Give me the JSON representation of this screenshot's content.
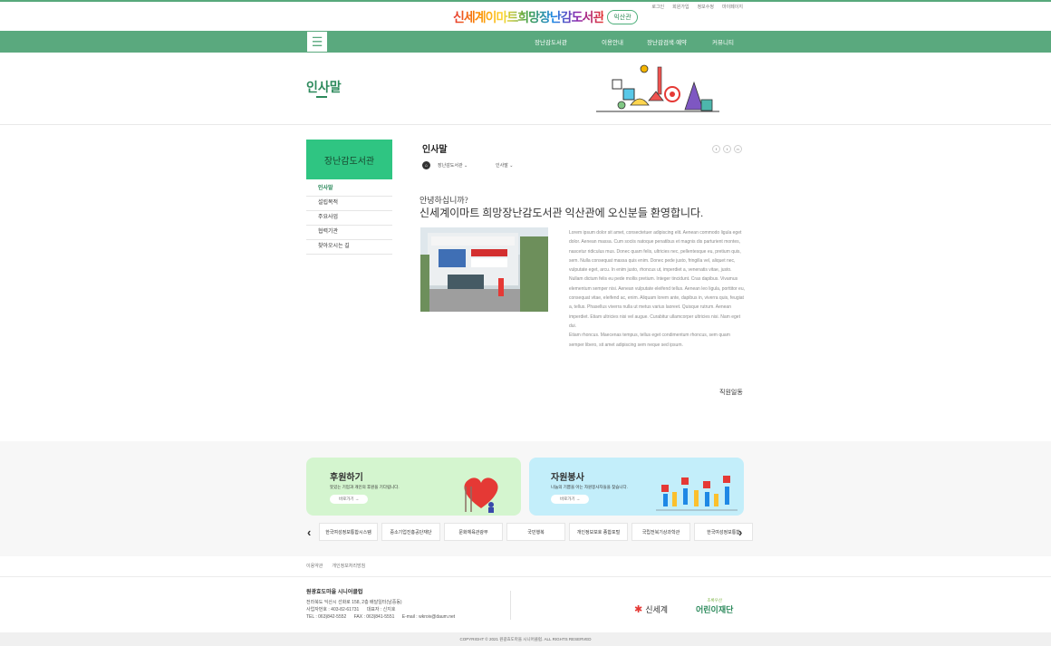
{
  "header": {
    "logo_text": "신세계이마트희망장난감도서관",
    "logo_badge": "익산관",
    "util_links": [
      "로그인",
      "회원가입",
      "정보수정",
      "마이페이지"
    ]
  },
  "nav": {
    "items": [
      "장난감도서관",
      "이용안내",
      "장난감검색·예약",
      "커뮤니티"
    ]
  },
  "banner": {
    "title": "인사말"
  },
  "sidebar": {
    "heading": "장난감도서관",
    "items": [
      {
        "label": "인사말",
        "active": true
      },
      {
        "label": "설립목적",
        "active": false
      },
      {
        "label": "주요사업",
        "active": false
      },
      {
        "label": "협력기관",
        "active": false
      },
      {
        "label": "찾아오시는 길",
        "active": false
      }
    ]
  },
  "content": {
    "title": "인사말",
    "share_icons": [
      "facebook-icon",
      "twitter-icon",
      "naver-icon"
    ],
    "breadcrumb": [
      "장난감도서관",
      "인사말"
    ],
    "greeting_small": "안녕하십니까?",
    "greeting_large": "신세계이마트 희망장난감도서관 익산관에 오신분들 환영합니다.",
    "body": "Lorem ipsum dolor sit amet, consectetuer adipiscing elit. Aenean commodo ligula eget dolor. Aenean massa. Cum sociis natoque penatibus et magnis dis parturient montes, nascetur ridiculus mus. Donec quam felis, ultricies nec, pellentesque eu, pretium quis, sem. Nulla consequat massa quis enim. Donec pede justo, fringilla vel, aliquet nec, vulputate eget, arcu. In enim justo, rhoncus ut, imperdiet a, venenatis vitae, justo. Nullam dictum felis eu pede mollis pretium. Integer tincidunt. Cras dapibus. Vivamus elementum semper nisi. Aenean vulputate eleifend tellus. Aenean leo ligula, porttitor eu, consequat vitae, eleifend ac, enim. Aliquam lorem ante, dapibus in, viverra quis, feugiat a, tellus. Phasellus viverra nulla ut metus varius laoreet. Quisque rutrum. Aenean imperdiet. Etiam ultricies nisi vel augue. Curabitur ullamcorper ultricies nisi. Nam eget dui.",
    "body2": "Etiam rhoncus. Maecenas tempus, tellus eget condimentum rhoncus, sem quam semper libero, sit amet adipiscing sem neque sed ipsum.",
    "signature": "직원일동"
  },
  "cards": [
    {
      "title": "후원하기",
      "desc": "뜻있는 기업과 개인의 후원을 기다립니다.",
      "button": "바로가기"
    },
    {
      "title": "자원봉사",
      "desc": "나눔의 기쁨을 아는 자원봉사자들을 찾습니다.",
      "button": "바로가기"
    }
  ],
  "partners": [
    "한국여성정보통합시스템",
    "중소기업진흥공단재단",
    "문화체육관광부",
    "국민행복",
    "개인정보보호 종합포털",
    "국립전북기상과학관",
    "한국여성정보통합"
  ],
  "footer": {
    "links": [
      "이용약관",
      "개인정보처리방침"
    ],
    "org_name": "원광효도마을 시니어클럽",
    "address": "전라북도 익산시 선화로 158, 2층 배달일터(남중동)",
    "reg": "사업자번호 : 403-82-61731",
    "rep": "대표자 : 신지호",
    "tel": "TEL : 063)842-5552",
    "fax": "FAX : 063)841-5551",
    "email": "E-mail : wkroiv@daum.net",
    "sponsor1": "신세계",
    "sponsor2_small": "초록우산",
    "sponsor2": "어린이재단",
    "copyright": "COPYRIGHT © 2021 원광효도마을 시니어클럽. ALL RIGHTS RESERVED"
  },
  "colors": {
    "brand_green": "#5aa97e",
    "sidebar_green": "#2fc582",
    "card_green": "#d4f5cf",
    "card_blue": "#c3eefa"
  }
}
